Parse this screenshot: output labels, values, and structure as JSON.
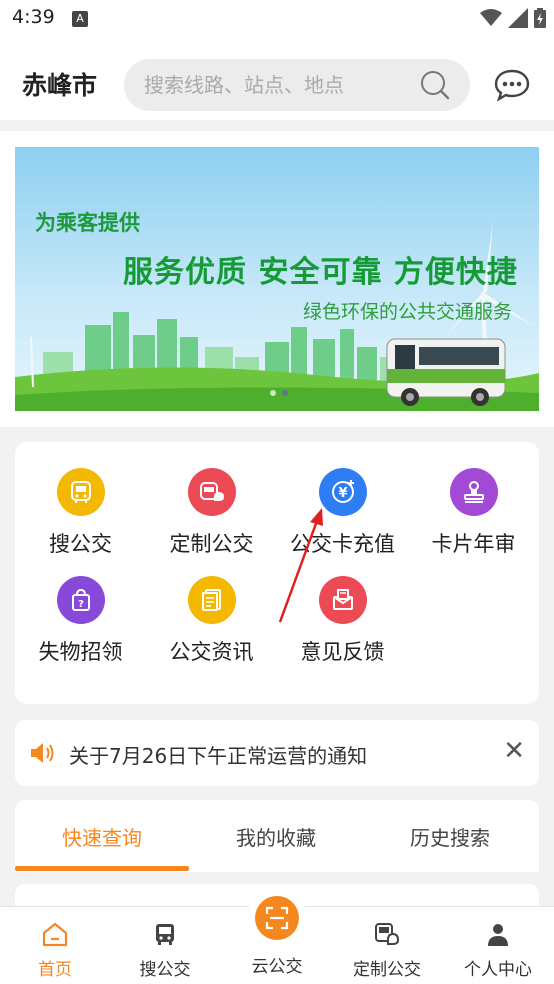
{
  "status_bar": {
    "time": "4:39",
    "notification_icon": "A"
  },
  "header": {
    "city": "赤峰市",
    "search_placeholder": "搜索线路、站点、地点"
  },
  "banner": {
    "line1": "为乘客提供",
    "line2": "服务优质  安全可靠  方便快捷",
    "line3": "绿色环保的公共交通服务",
    "slide_count": 2,
    "active_slide": 2
  },
  "services": [
    {
      "label": "搜公交",
      "icon": "bus-search-icon",
      "color": "#f5b800"
    },
    {
      "label": "定制公交",
      "icon": "custom-bus-icon",
      "color": "#ec4a55"
    },
    {
      "label": "公交卡充值",
      "icon": "card-recharge-icon",
      "color": "#2f7df2"
    },
    {
      "label": "卡片年审",
      "icon": "stamp-icon",
      "color": "#a249d6"
    },
    {
      "label": "失物招领",
      "icon": "lost-found-bag-icon",
      "color": "#8848d8"
    },
    {
      "label": "公交资讯",
      "icon": "news-icon",
      "color": "#f5b800"
    },
    {
      "label": "意见反馈",
      "icon": "feedback-icon",
      "color": "#ec4a55"
    }
  ],
  "notice": {
    "text": "关于7月26日下午正常运营的通知"
  },
  "tabs": [
    {
      "label": "快速查询",
      "active": true
    },
    {
      "label": "我的收藏",
      "active": false
    },
    {
      "label": "历史搜索",
      "active": false
    }
  ],
  "bottom_nav": [
    {
      "label": "首页",
      "icon": "home-icon",
      "active": true
    },
    {
      "label": "搜公交",
      "icon": "bus-icon",
      "active": false
    },
    {
      "label": "云公交",
      "icon": "scan-icon",
      "active": false
    },
    {
      "label": "定制公交",
      "icon": "custom-bus-icon",
      "active": false
    },
    {
      "label": "个人中心",
      "icon": "person-icon",
      "active": false
    }
  ],
  "colors": {
    "accent": "#f5871f",
    "banner_green": "#169a36"
  }
}
